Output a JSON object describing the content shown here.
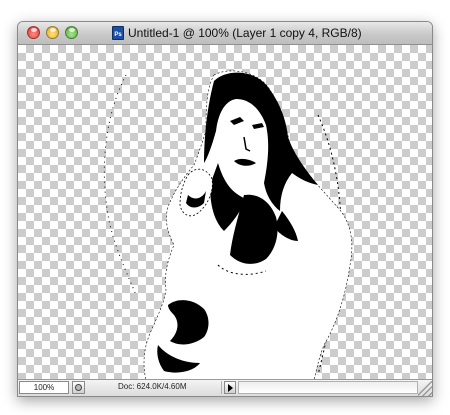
{
  "window": {
    "title": "Untitled-1 @ 100% (Layer 1 copy 4, RGB/8)",
    "app_icon": "photoshop-document-icon",
    "app_icon_text": "Ps"
  },
  "controls": {
    "close": "close-button",
    "minimize": "minimize-button",
    "zoom": "zoom-button"
  },
  "status": {
    "zoom": "100%",
    "doc_info": "Doc: 624.0K/4.60M"
  },
  "colors": {
    "checker_light": "#ffffff",
    "checker_dark": "#cccccc",
    "layer_black": "#000000",
    "layer_white": "#ffffff"
  }
}
